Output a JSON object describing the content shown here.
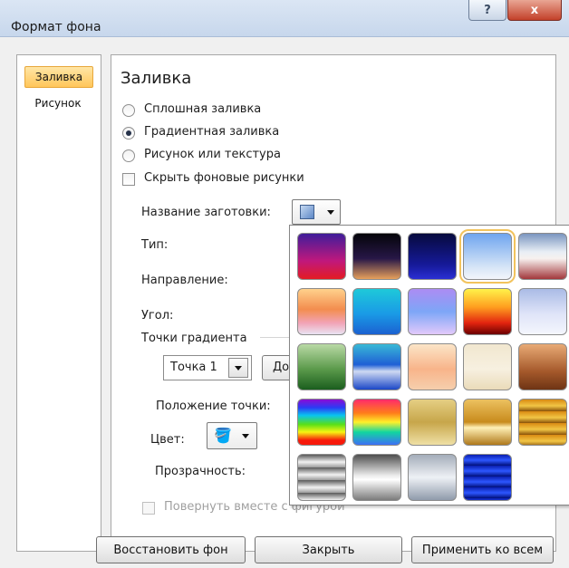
{
  "window": {
    "title": "Формат фона",
    "help_label": "?",
    "close_label": "x"
  },
  "nav": {
    "items": [
      {
        "label": "Заливка",
        "selected": true
      },
      {
        "label": "Рисунок",
        "selected": false
      }
    ]
  },
  "panel": {
    "heading": "Заливка",
    "fill_options": [
      {
        "label": "Сплошная заливка",
        "checked": false
      },
      {
        "label": "Градиентная заливка",
        "checked": true
      },
      {
        "label": "Рисунок или текстура",
        "checked": false
      }
    ],
    "hide_background_label": "Скрыть фоновые рисунки",
    "preset_label": "Название заготовки:",
    "type_label": "Тип:",
    "direction_label": "Направление:",
    "angle_label": "Угол:",
    "gradient_stops_label": "Точки градиента",
    "stop_select_value": "Точка 1",
    "add_button_label": "До",
    "position_label": "Положение точки:",
    "color_label": "Цвет:",
    "transparency_label": "Прозрачность:",
    "rotate_with_shape_label": "Повернуть вместе с фигурой"
  },
  "buttons": {
    "restore": "Восстановить фон",
    "close": "Закрыть",
    "apply_all": "Применить ко всем"
  },
  "gallery": {
    "swatches": [
      "preset-1",
      "preset-2",
      "preset-3",
      "preset-4",
      "preset-5",
      "preset-6",
      "preset-7",
      "preset-8",
      "preset-9",
      "preset-10",
      "preset-11",
      "preset-12",
      "preset-13",
      "preset-14",
      "preset-15",
      "preset-16",
      "preset-17",
      "preset-18",
      "preset-19",
      "preset-20",
      "preset-21",
      "preset-22",
      "preset-23",
      "preset-24"
    ],
    "selected_index": 4
  }
}
